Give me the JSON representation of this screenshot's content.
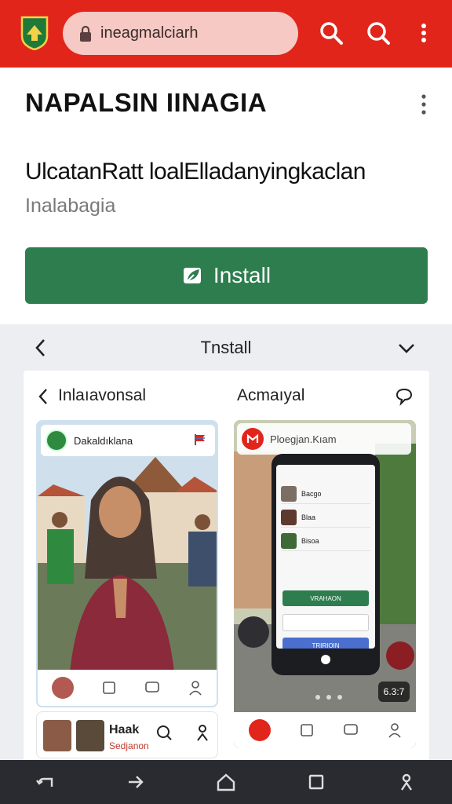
{
  "browser": {
    "url": "ineagmalciarh"
  },
  "app": {
    "title": "NAPALSIN IINAGIA",
    "subtitle": "UlcatanRatt loalElladanyingkaclan",
    "developer": "Inalabagia",
    "install_label": "Install"
  },
  "section": {
    "title": "Tnstall"
  },
  "card": {
    "left_title": "Inlaıavonsal",
    "right_title": "Acmaıyal"
  },
  "shot1": {
    "top_label": "Dakaldıklana"
  },
  "shot2": {
    "top_label": "Ploegjan.Kıam",
    "rows": [
      {
        "text": "Bacgo"
      },
      {
        "text": "Blaa"
      },
      {
        "text": "Bisoa"
      }
    ],
    "green_button": "VRAHAON",
    "box_text": "",
    "blue_button": "TRIRIOIN",
    "badge": "6.3:7"
  },
  "mini": {
    "name": "Haak",
    "sub": "Sedjanon"
  },
  "colors": {
    "brand_red": "#e1251b",
    "install_green": "#2e7d4f",
    "nav_dark": "#2a2b30"
  }
}
